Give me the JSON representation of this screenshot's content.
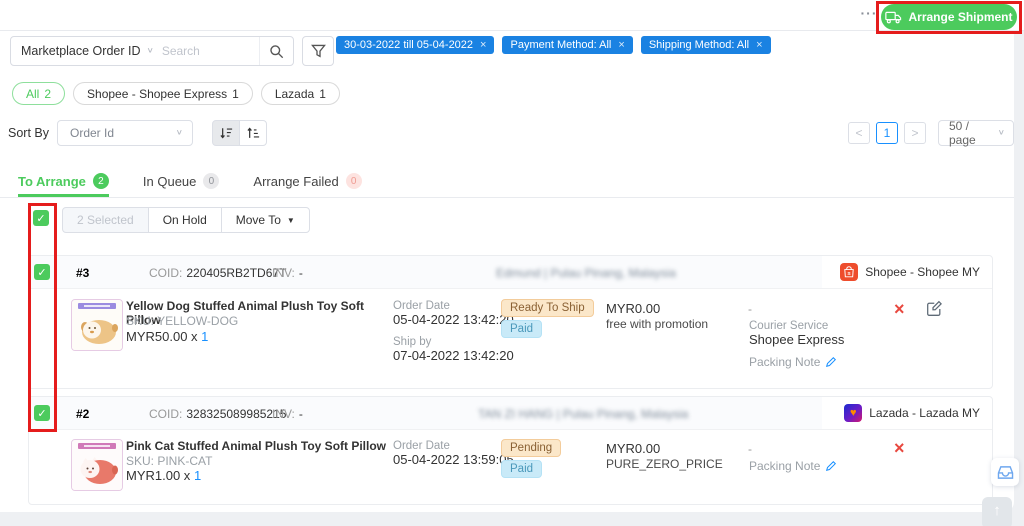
{
  "colors": {
    "green": "#4ccb5d",
    "chip_blue": "#1a82e2",
    "link_blue": "#1890ff",
    "danger_red": "#e8483f",
    "annotation_red": "#e51c1c"
  },
  "icons": {
    "more_glyph": "···",
    "close_glyph": "×",
    "check_glyph": "✓",
    "chevron_glyph": "∨",
    "caret_glyph": "▼",
    "prev_glyph": "<",
    "next_glyph": ">",
    "up_glyph": "↑",
    "heart_glyph": "♥",
    "dash_glyph": "-"
  },
  "header": {
    "arrange_shipment_label": "Arrange Shipment"
  },
  "search_bar": {
    "type_selector": "Marketplace Order ID",
    "placeholder": "Search",
    "chips": [
      "30-03-2022 till 05-04-2022",
      "Payment Method: All",
      "Shipping Method: All"
    ]
  },
  "channel_pills": [
    {
      "label": "All",
      "count": "2"
    },
    {
      "label": "Shopee - Shopee Express",
      "count": "1"
    },
    {
      "label": "Lazada",
      "count": "1"
    }
  ],
  "sort": {
    "label": "Sort By",
    "value": "Order Id"
  },
  "pagination": {
    "page": "1",
    "size": "50 / page"
  },
  "status_tabs": [
    {
      "label": "To Arrange",
      "count": "2"
    },
    {
      "label": "In Queue",
      "count": "0"
    },
    {
      "label": "Arrange Failed",
      "count": "0"
    }
  ],
  "bulk_bar": {
    "selected_label": "2 Selected",
    "on_hold_label": "On Hold",
    "move_to_label": "Move To"
  },
  "orders": [
    {
      "number": "#3",
      "coid_label": "COID:",
      "coid": "220405RB2TD67T",
      "inv_label": "INV:",
      "inv": "-",
      "customer": "Edmund  |  Pulau Pinang, Malaysia",
      "store": "Shopee - Shopee MY",
      "store_icon": "shopee-icon",
      "product": {
        "name": "Yellow Dog Stuffed Animal Plush Toy Soft Pillow",
        "sku": "SKU: YELLOW-DOG",
        "price": "MYR50.00 x",
        "qty": "1"
      },
      "order_date_label": "Order Date",
      "order_date": "05-04-2022 13:42:20",
      "ship_by_label": "Ship by",
      "ship_by": "07-04-2022 13:42:20",
      "status_badge": "Ready To Ship",
      "payment_badge": "Paid",
      "amount": "MYR0.00",
      "amount_note": "free with promotion",
      "tracking": "-",
      "courier_label": "Courier Service",
      "courier": "Shopee Express",
      "packing_note_label": "Packing Note"
    },
    {
      "number": "#2",
      "coid_label": "COID:",
      "coid": "328325089985215",
      "inv_label": "INV:",
      "inv": "-",
      "customer": "TAN ZI HANG  |  Pulau Pinang, Malaysia",
      "store": "Lazada - Lazada MY",
      "store_icon": "lazada-icon",
      "product": {
        "name": "Pink Cat Stuffed Animal Plush Toy Soft Pillow",
        "sku": "SKU: PINK-CAT",
        "price": "MYR1.00 x",
        "qty": "1"
      },
      "order_date_label": "Order Date",
      "order_date": "05-04-2022 13:59:05",
      "status_badge": "Pending",
      "payment_badge": "Paid",
      "amount": "MYR0.00",
      "amount_note": "PURE_ZERO_PRICE",
      "tracking": "-",
      "packing_note_label": "Packing Note"
    }
  ]
}
